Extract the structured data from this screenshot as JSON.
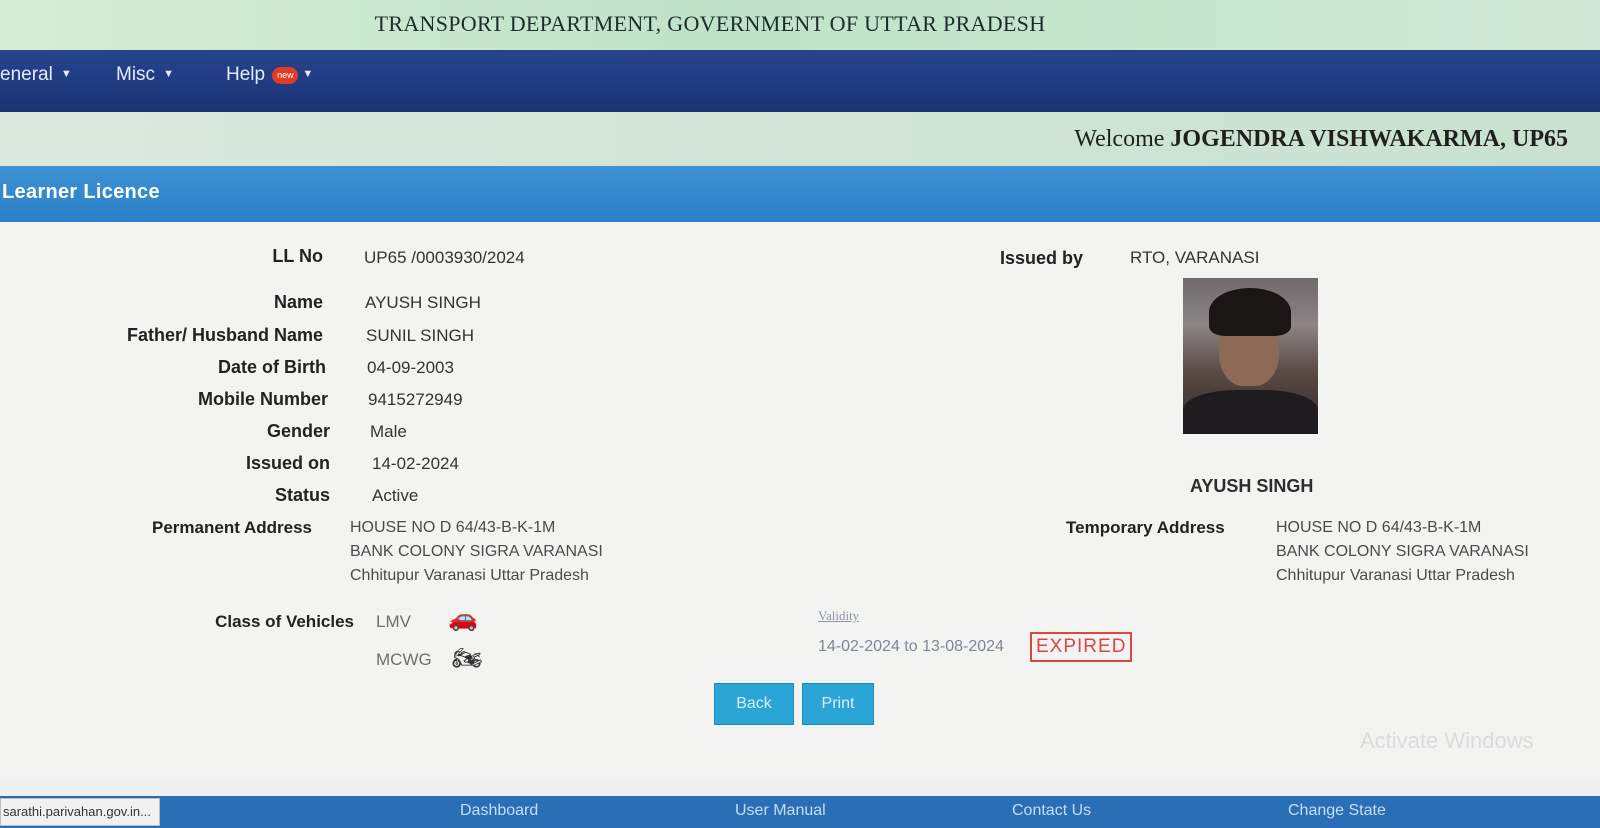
{
  "banner": {
    "title": "TRANSPORT DEPARTMENT, GOVERNMENT OF UTTAR PRADESH"
  },
  "nav": {
    "items": [
      {
        "label": "eneral"
      },
      {
        "label": "Misc"
      },
      {
        "label": "Help"
      }
    ],
    "help_badge": "new"
  },
  "welcome": {
    "prefix": "Welcome",
    "user": "JOGENDRA VISHWAKARMA, UP65"
  },
  "section": {
    "title": "Learner Licence"
  },
  "licence": {
    "ll_no_label": "LL No",
    "ll_no": "UP65 /0003930/2024",
    "issued_by_label": "Issued by",
    "issued_by": "RTO, VARANASI",
    "name_label": "Name",
    "name": "AYUSH SINGH",
    "father_label": "Father/ Husband Name",
    "father": "SUNIL SINGH",
    "dob_label": "Date of Birth",
    "dob": "04-09-2003",
    "mobile_label": "Mobile Number",
    "mobile": "9415272949",
    "gender_label": "Gender",
    "gender": "Male",
    "issued_on_label": "Issued on",
    "issued_on": "14-02-2024",
    "status_label": "Status",
    "status": "Active",
    "photo_caption": "AYUSH SINGH",
    "perm_addr_label": "Permanent Address",
    "perm_addr": [
      "HOUSE NO D 64/43-B-K-1M",
      "BANK COLONY SIGRA VARANASI",
      "Chhitupur Varanasi Uttar Pradesh"
    ],
    "temp_addr_label": "Temporary Address",
    "temp_addr": [
      "HOUSE NO D 64/43-B-K-1M",
      "BANK COLONY SIGRA VARANASI",
      "Chhitupur Varanasi Uttar Pradesh"
    ],
    "cov_label": "Class of Vehicles",
    "cov": [
      {
        "code": "LMV",
        "icon": "car-icon"
      },
      {
        "code": "MCWG",
        "icon": "motorcycle-icon"
      }
    ],
    "validity_label": "Validity",
    "validity": "14-02-2024 to 13-08-2024",
    "expired": "EXPIRED"
  },
  "buttons": {
    "back": "Back",
    "print": "Print"
  },
  "footer": {
    "url": "sarathi.parivahan.gov.in...",
    "links": [
      "Dashboard",
      "User Manual",
      "Contact Us",
      "Change State"
    ]
  },
  "overlay": {
    "watermark": "Activate Windows"
  },
  "colors": {
    "navbar": "#1e3a80",
    "section": "#2a7fc6",
    "expired": "#d94747",
    "button": "#2ba4d6"
  }
}
